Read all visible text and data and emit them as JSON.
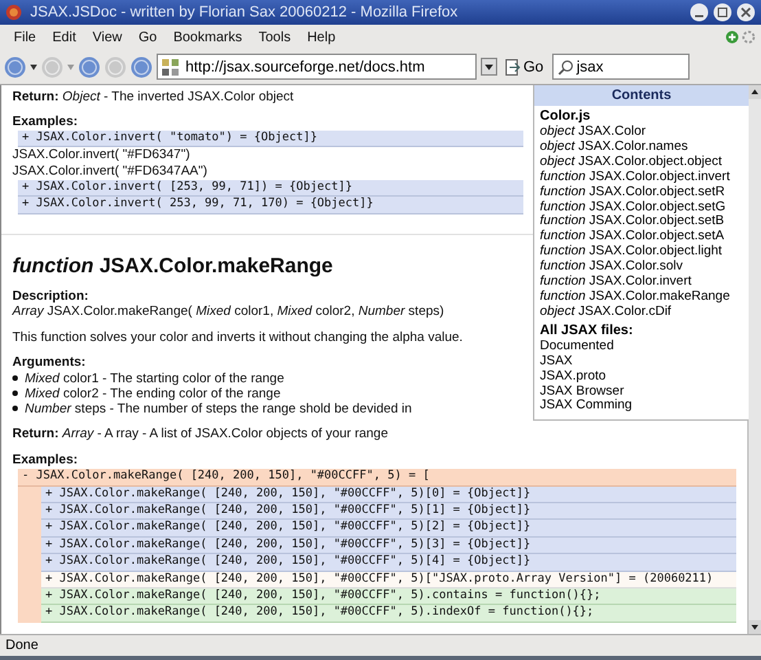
{
  "window": {
    "title": "JSAX.JSDoc - written by Florian Sax 20060212 - Mozilla Firefox"
  },
  "menu": [
    "File",
    "Edit",
    "View",
    "Go",
    "Bookmarks",
    "Tools",
    "Help"
  ],
  "toolbar": {
    "url": "http://jsax.sourceforge.net/docs.htm",
    "go": "Go",
    "search": "jsax"
  },
  "doc": {
    "top_return": "**Return:** *Object* - The inverted JSAX.Color object",
    "examples_1": {
      "heading": "Examples:",
      "rows": [
        {
          "kind": "object",
          "text": "+ JSAX.Color.invert( \"tomato\") = {Object]}"
        },
        {
          "kind": "plain",
          "text": "JSAX.Color.invert( \"#FD6347\")"
        },
        {
          "kind": "plain",
          "text": "JSAX.Color.invert( \"#FD6347AA\")"
        },
        {
          "kind": "object",
          "text": "+ JSAX.Color.invert( [253, 99, 71]) = {Object]}"
        },
        {
          "kind": "object",
          "text": "+ JSAX.Color.invert( 253, 99, 71, 170) = {Object]}"
        }
      ]
    },
    "function_heading": "*function* JSAX.Color.makeRange",
    "description_label": "Description:",
    "signature": "*Array* JSAX.Color.makeRange( *Mixed* color1, *Mixed* color2, *Number* steps)",
    "paragraph": "This function solves your color and inverts it without changing the alpha value.",
    "arguments_label": "Arguments:",
    "arguments": [
      "*Mixed* color1 - The starting color of the range",
      "*Mixed* color2 - The ending color of the range",
      "*Number* steps - The number of steps the range shold be devided in"
    ],
    "return": "**Return:** *Array* - A rray - A list of JSAX.Color objects of your range",
    "examples_2": {
      "heading": "Examples:",
      "rows": [
        {
          "kind": "array",
          "text": "- JSAX.Color.makeRange( [240, 200, 150], \"#00CCFF\", 5) = [",
          "children": [
            {
              "kind": "object",
              "text": "+ JSAX.Color.makeRange( [240, 200, 150], \"#00CCFF\", 5)[0] = {Object]}"
            },
            {
              "kind": "object",
              "text": "+ JSAX.Color.makeRange( [240, 200, 150], \"#00CCFF\", 5)[1] = {Object]}"
            },
            {
              "kind": "object",
              "text": "+ JSAX.Color.makeRange( [240, 200, 150], \"#00CCFF\", 5)[2] = {Object]}"
            },
            {
              "kind": "object",
              "text": "+ JSAX.Color.makeRange( [240, 200, 150], \"#00CCFF\", 5)[3] = {Object]}"
            },
            {
              "kind": "object",
              "text": "+ JSAX.Color.makeRange( [240, 200, 150], \"#00CCFF\", 5)[4] = {Object]}"
            },
            {
              "kind": "string",
              "text": "+ JSAX.Color.makeRange( [240, 200, 150], \"#00CCFF\", 5)[\"JSAX.proto.Array Version\"] = (20060211)"
            },
            {
              "kind": "function",
              "text": "+ JSAX.Color.makeRange( [240, 200, 150], \"#00CCFF\", 5).contains = function(){};"
            },
            {
              "kind": "function",
              "text": "+ JSAX.Color.makeRange( [240, 200, 150], \"#00CCFF\", 5).indexOf = function(){};"
            }
          ]
        }
      ]
    }
  },
  "contents": {
    "title": "Contents",
    "sections": [
      {
        "heading": "Color.js",
        "items": [
          "*object* JSAX.Color",
          "*object* JSAX.Color.names",
          "*object* JSAX.Color.object.object",
          "*function* JSAX.Color.object.invert",
          "*function* JSAX.Color.object.setR",
          "*function* JSAX.Color.object.setG",
          "*function* JSAX.Color.object.setB",
          "*function* JSAX.Color.object.setA",
          "*function* JSAX.Color.object.light",
          "*function* JSAX.Color.solv",
          "*function* JSAX.Color.invert",
          "*function* JSAX.Color.makeRange",
          "*object* JSAX.Color.cDif"
        ]
      },
      {
        "heading": "All JSAX files:",
        "items": [
          "Documented",
          "JSAX",
          "JSAX.proto",
          "JSAX Browser",
          "JSAX Comming"
        ]
      }
    ]
  },
  "status_bar": "Done"
}
